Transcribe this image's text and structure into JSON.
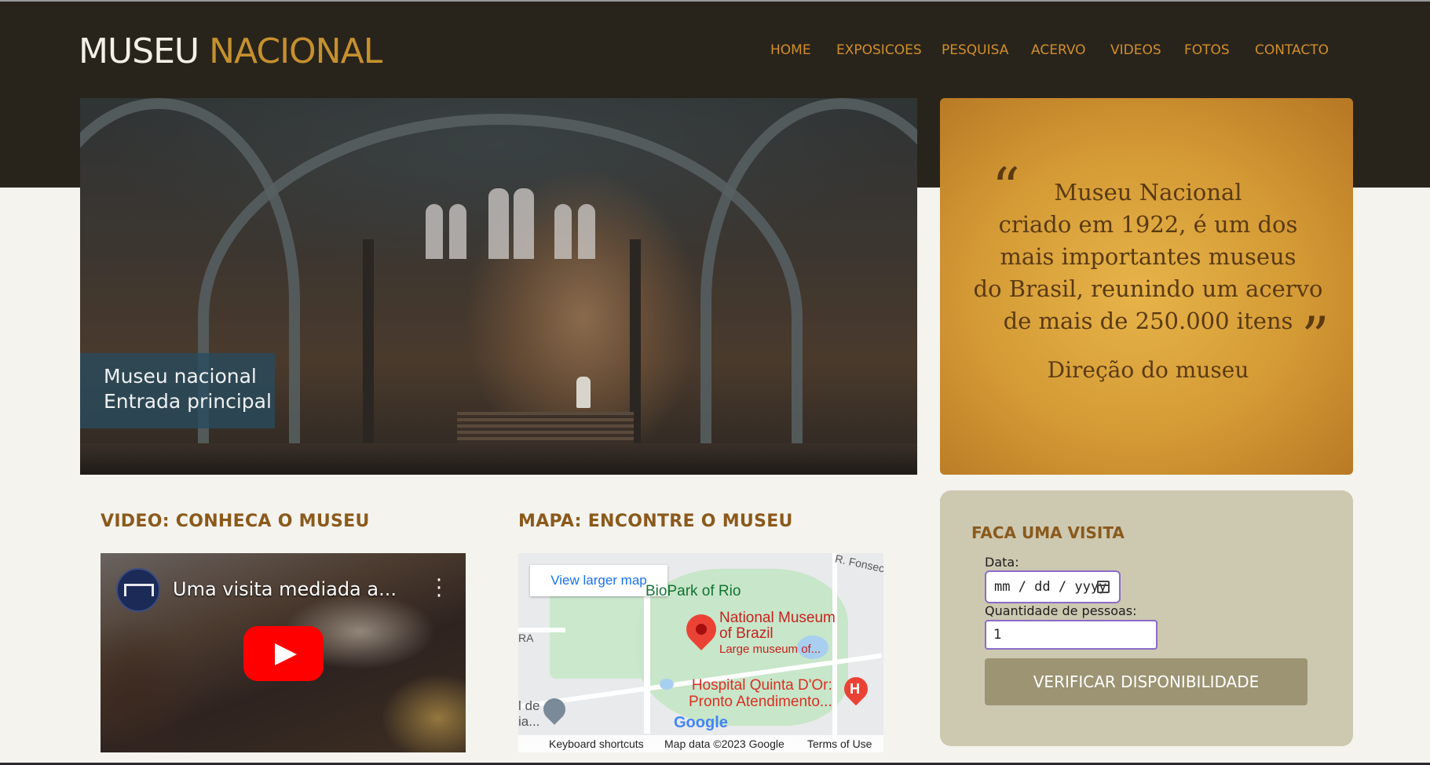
{
  "header": {
    "logo_part1": "MUSEU",
    "logo_part2": "NACIONAL",
    "nav": [
      "HOME",
      "EXPOSICOES",
      "PESQUISA",
      "ACERVO",
      "VIDEOS",
      "FOTOS",
      "CONTACTO"
    ]
  },
  "hero": {
    "caption_line1": "Museu nacional",
    "caption_line2": "Entrada principal"
  },
  "quote": {
    "open_mark": "“",
    "close_mark": "”",
    "line1": "Museu Nacional",
    "line2": "criado em 1922, é um dos",
    "line3": "mais importantes museus",
    "line4": "do Brasil, reunindo um acervo",
    "line5": "de mais de 250.000 itens",
    "author": "Direção do museu"
  },
  "video": {
    "section_title": "VIDEO: CONHECA O MUSEU",
    "title": "Uma visita mediada a...",
    "channel_icon": "museu-nacional-logo",
    "menu_icon": "more-vert-icon",
    "play_icon": "youtube-play-icon"
  },
  "map": {
    "section_title": "MAPA: ENCONTRE O MUSEU",
    "larger_map_link": "View larger map",
    "label_biopark": "BioPark of Rio",
    "label_museum_1": "National Museum",
    "label_museum_2": "of Brazil",
    "label_museum_3": "Large museum of...",
    "label_hospital_1": "Hospital Quinta D'Or:",
    "label_hospital_2": "Pronto Atendimento...",
    "label_street": "R. Fonsec",
    "label_ra": "RA",
    "label_left_1": "l de",
    "label_left_2": "ia...",
    "google": "Google",
    "footer_shortcuts": "Keyboard shortcuts",
    "footer_data": "Map data ©2023 Google",
    "footer_terms": "Terms of Use"
  },
  "visit": {
    "title": "FACA UMA VISITA",
    "date_label": "Data:",
    "date_placeholder": "mm / dd / yyyy",
    "qty_label": "Quantidade de pessoas:",
    "qty_value": "1",
    "button": "VERIFICAR DISPONIBILIDADE"
  },
  "colors": {
    "header_bg": "#29241b",
    "accent": "#cf8e2e",
    "section_title": "#8a5a1c",
    "visit_bg": "#cdc8b0",
    "button_bg": "#9c9473"
  }
}
